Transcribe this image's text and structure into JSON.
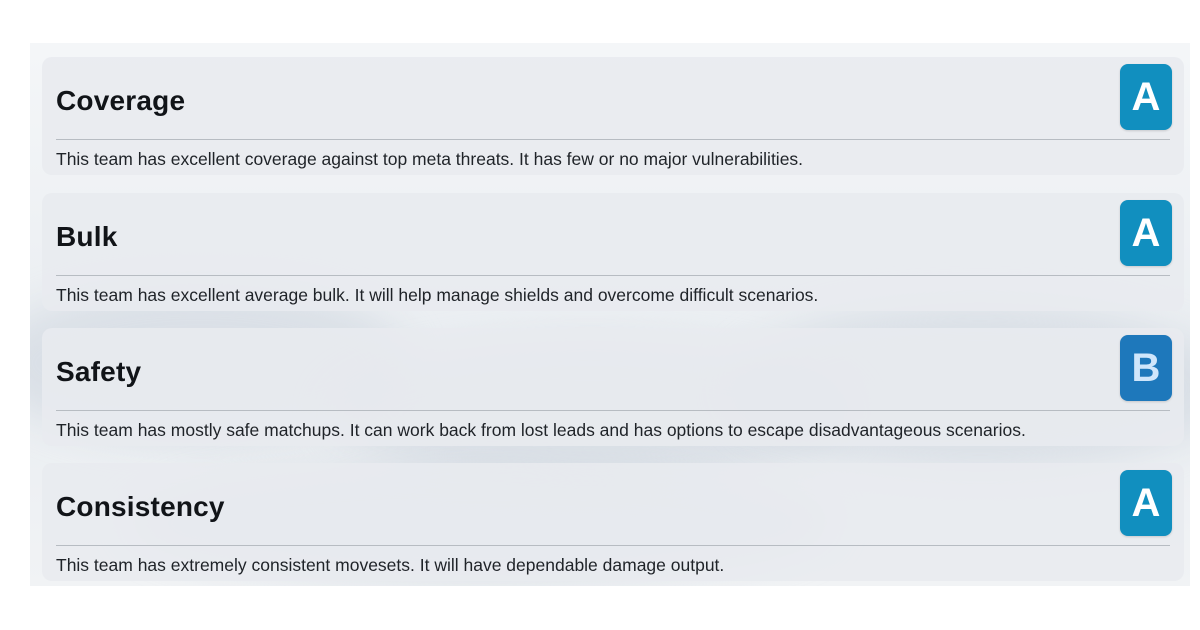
{
  "ratings": [
    {
      "title": "Coverage",
      "grade": "A",
      "grade_color": "#118fbf",
      "description": "This team has excellent coverage against top meta threats. It has few or no major vulnerabilities."
    },
    {
      "title": "Bulk",
      "grade": "A",
      "grade_color": "#118fbf",
      "description": "This team has excellent average bulk. It will help manage shields and overcome difficult scenarios."
    },
    {
      "title": "Safety",
      "grade": "B",
      "grade_color": "#1e78bb",
      "description": "This team has mostly safe matchups. It can work back from lost leads and has options to escape disadvantageous scenarios."
    },
    {
      "title": "Consistency",
      "grade": "A",
      "grade_color": "#118fbf",
      "description": "This team has extremely consistent movesets. It will have dependable damage output."
    }
  ]
}
